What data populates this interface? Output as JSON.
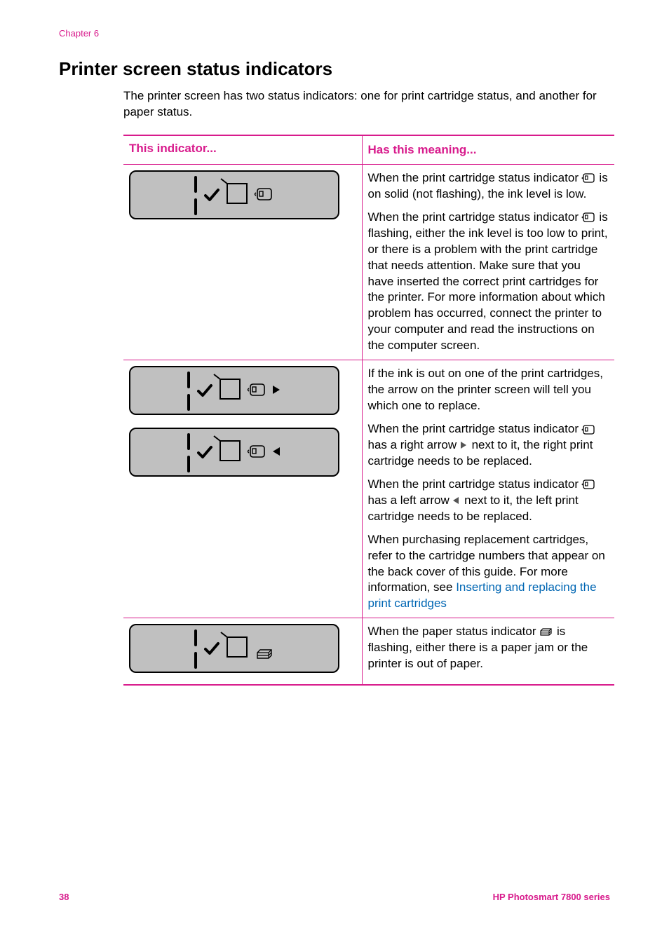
{
  "chapterLabel": "Chapter 6",
  "pageTitle": "Printer screen status indicators",
  "intro": "The printer screen has two status indicators: one for print cartridge status, and another for paper status.",
  "table": {
    "headLeft": "This indicator...",
    "headRight": "Has this meaning...",
    "row1": {
      "p1a": "When the print cartridge status indicator ",
      "p1b": " is on solid (not flashing), the ink level is low.",
      "p2a": "When the print cartridge status indicator ",
      "p2b": " is flashing, either the ink level is too low to print, or there is a problem with the print cartridge that needs attention. Make sure that you have inserted the correct print cartridges for the printer. For more information about which problem has occurred, connect the printer to your computer and read the instructions on the computer screen."
    },
    "row2": {
      "p1": "If the ink is out on one of the print cartridges, the arrow on the printer screen will tell you which one to replace.",
      "p2a": "When the print cartridge status indicator ",
      "p2b": " has a right arrow ",
      "p2c": " next to it, the right print cartridge needs to be replaced.",
      "p3a": "When the print cartridge status indicator ",
      "p3b": " has a left arrow ",
      "p3c": " next to it, the left print cartridge needs to be replaced.",
      "p4a": "When purchasing replacement cartridges, refer to the cartridge numbers that appear on the back cover of this guide. For more information, see ",
      "p4link": "Inserting and replacing the print cartridges"
    },
    "row3": {
      "p1a": "When the paper status indicator ",
      "p1b": " is flashing, either there is a paper jam or the printer is out of paper."
    }
  },
  "footer": {
    "pageNum": "38",
    "model": "HP Photosmart 7800 series"
  }
}
